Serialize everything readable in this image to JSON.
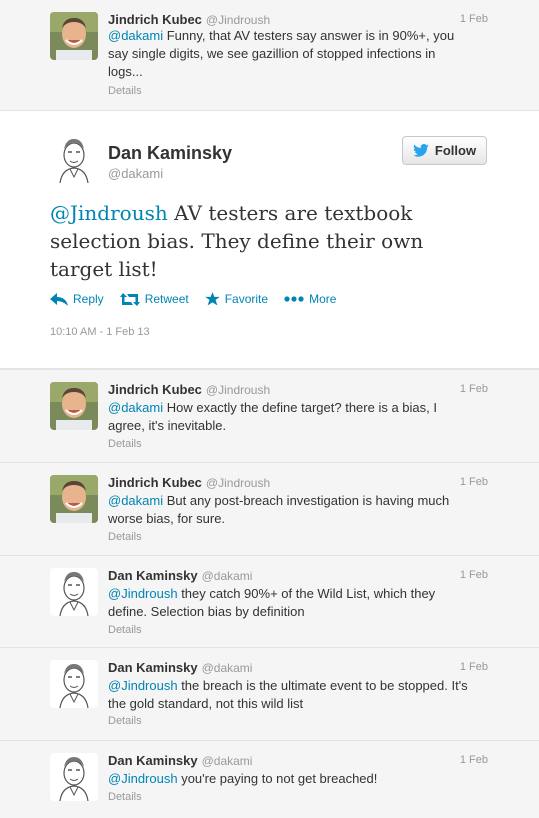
{
  "top_tweet": {
    "name": "Jindrich Kubec",
    "handle": "@Jindroush",
    "time": "1 Feb",
    "mention": "@dakami",
    "text": " Funny, that AV testers say answer is in 90%+, you say single digits, we see gazillion of stopped infections in logs...",
    "details": "Details"
  },
  "main_tweet": {
    "name": "Dan Kaminsky",
    "handle": "@dakami",
    "follow_label": "Follow",
    "mention": "@Jindroush",
    "text": " AV testers are textbook selection bias. They define their own target list!",
    "actions": {
      "reply": "Reply",
      "retweet": "Retweet",
      "favorite": "Favorite",
      "more": "More"
    },
    "timestamp": "10:10 AM - 1 Feb 13"
  },
  "replies": [
    {
      "name": "Jindrich Kubec",
      "handle": "@Jindroush",
      "time": "1 Feb",
      "mention": "@dakami",
      "text": " How exactly the define target? there is a bias, I agree, it's inevitable.",
      "details": "Details"
    },
    {
      "name": "Jindrich Kubec",
      "handle": "@Jindroush",
      "time": "1 Feb",
      "mention": "@dakami",
      "text": " But any post-breach investigation is having much worse bias, for sure.",
      "details": "Details"
    },
    {
      "name": "Dan Kaminsky",
      "handle": "@dakami",
      "time": "1 Feb",
      "mention": "@Jindroush",
      "text": " they catch 90%+ of the Wild List, which they define. Selection bias by definition",
      "details": "Details"
    },
    {
      "name": "Dan Kaminsky",
      "handle": "@dakami",
      "time": "1 Feb",
      "mention": "@Jindroush",
      "text": " the breach is the ultimate event to be stopped. It's the gold standard, not this wild list",
      "details": "Details"
    },
    {
      "name": "Dan Kaminsky",
      "handle": "@dakami",
      "time": "1 Feb",
      "mention": "@Jindroush",
      "text": " you're paying to not get breached!",
      "details": "Details"
    }
  ]
}
